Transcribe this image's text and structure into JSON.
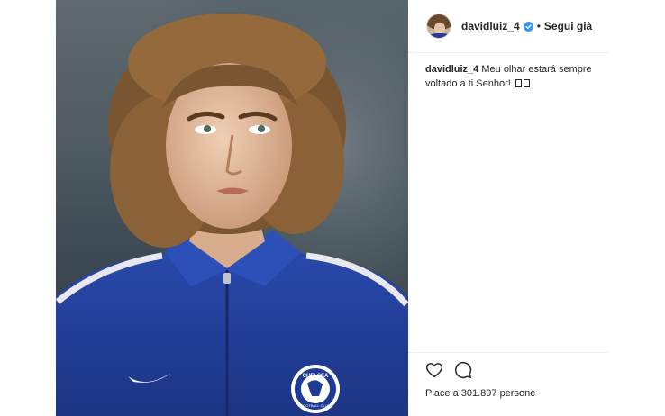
{
  "post": {
    "username": "davidluiz_4",
    "follow_label": "Segui già",
    "separator": "•",
    "caption_text": "Meu olhar estará sempre voltado a ti Senhor!",
    "likes_text": "Piace a 301.897 persone"
  },
  "photo": {
    "crest_text_top": "CHELSEA",
    "crest_text_bottom": "FOOTBALL CLUB"
  },
  "icons": {
    "verified": "verified-badge-icon",
    "like": "heart-icon",
    "comment": "comment-icon"
  },
  "colors": {
    "verified_blue": "#3897f0",
    "jacket_blue": "#233e9a",
    "text": "#262626",
    "divider": "#efefef"
  }
}
